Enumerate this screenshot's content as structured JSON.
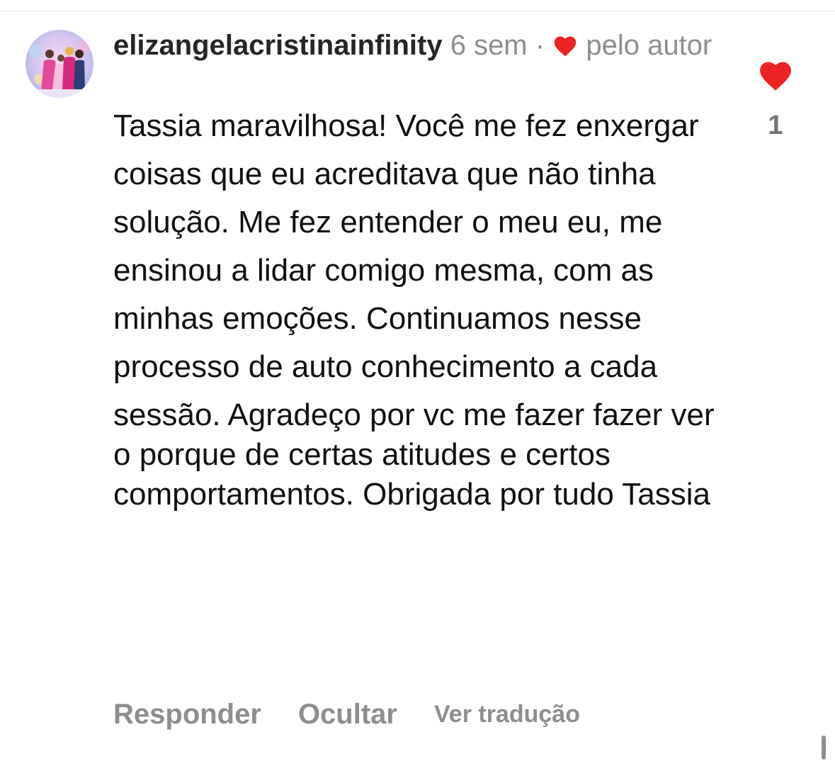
{
  "comment": {
    "username": "elizangelacristinainfinity",
    "time_ago": "6 sem",
    "separator": "·",
    "liked_by_author_label": "pelo autor",
    "paragraphs": [
      "Tassia maravilhosa! Você me fez enxergar",
      "coisas que eu acreditava que não tinha",
      "solução. Me fez entender o meu eu, me",
      "ensinou a lidar comigo mesma, com as",
      "minhas emoções. Continuamos nesse",
      "processo de auto conhecimento a cada",
      "sessão. Agradeço por vc me fazer fazer ver o porque de certas atitudes e certos comportamentos. Obrigada por tudo Tassia"
    ],
    "like_count": "1"
  },
  "actions": {
    "reply_label": "Responder",
    "hide_label": "Ocultar",
    "translate_label": "Ver tradução"
  },
  "icons": {
    "inline_heart": "heart-icon",
    "like_heart": "heart-filled-icon",
    "avatar": "profile-avatar"
  },
  "colors": {
    "heart": "#ed2224",
    "meta_text": "#8e8e8e",
    "username": "#262626",
    "like_count": "#737373"
  }
}
